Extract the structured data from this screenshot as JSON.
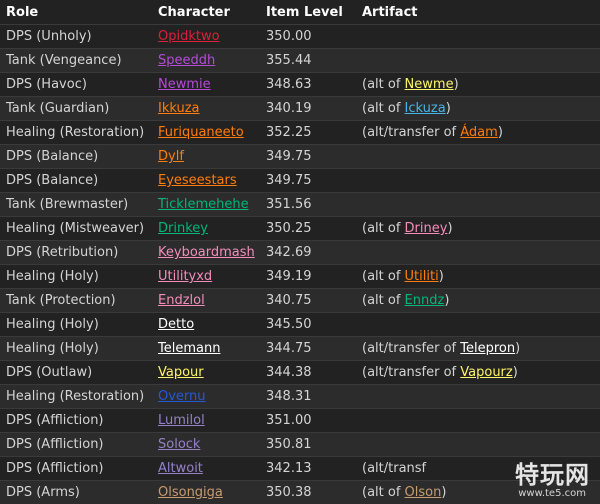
{
  "table": {
    "headers": {
      "role": "Role",
      "character": "Character",
      "item_level": "Item Level",
      "artifact": "Artifact"
    },
    "rows": [
      {
        "role": "DPS (Unholy)",
        "character": "Opidktwo",
        "color": "#d9213a",
        "ilvl": "350.00",
        "note": null
      },
      {
        "role": "Tank (Vengeance)",
        "character": "Speeddh",
        "color": "#b44bd6",
        "ilvl": "355.44",
        "note": null
      },
      {
        "role": "DPS (Havoc)",
        "character": "Newmie",
        "color": "#b44bd6",
        "ilvl": "348.63",
        "note": {
          "prefix": "(alt of ",
          "name": "Newme",
          "color": "#fff468",
          "suffix": ")"
        }
      },
      {
        "role": "Tank (Guardian)",
        "character": "Ikkuza",
        "color": "#ff7d0a",
        "ilvl": "340.19",
        "note": {
          "prefix": "(alt of ",
          "name": "Ickuza",
          "color": "#45b6e8",
          "suffix": ")"
        }
      },
      {
        "role": "Healing (Restoration)",
        "character": "Furiquaneeto",
        "color": "#ff7d0a",
        "ilvl": "352.25",
        "note": {
          "prefix": "(alt/transfer of ",
          "name": "Ádam",
          "color": "#ff7d0a",
          "suffix": ")"
        }
      },
      {
        "role": "DPS (Balance)",
        "character": "Dylf",
        "color": "#ff7d0a",
        "ilvl": "349.75",
        "note": null
      },
      {
        "role": "DPS (Balance)",
        "character": "Eyeseestars",
        "color": "#ff7d0a",
        "ilvl": "349.75",
        "note": null
      },
      {
        "role": "Tank (Brewmaster)",
        "character": "Ticklemehehe",
        "color": "#00b77a",
        "ilvl": "351.56",
        "note": null
      },
      {
        "role": "Healing (Mistweaver)",
        "character": "Drinkey",
        "color": "#00b77a",
        "ilvl": "350.25",
        "note": {
          "prefix": "(alt of ",
          "name": "Driney",
          "color": "#f58cba",
          "suffix": ")"
        }
      },
      {
        "role": "DPS (Retribution)",
        "character": "Keyboardmash",
        "color": "#f58cba",
        "ilvl": "342.69",
        "note": null
      },
      {
        "role": "Healing (Holy)",
        "character": "Utilityxd",
        "color": "#f58cba",
        "ilvl": "349.19",
        "note": {
          "prefix": "(alt of ",
          "name": "Utiliti",
          "color": "#ff7d0a",
          "suffix": ")"
        }
      },
      {
        "role": "Tank (Protection)",
        "character": "Endzlol",
        "color": "#f58cba",
        "ilvl": "340.75",
        "note": {
          "prefix": "(alt of ",
          "name": "Enndz",
          "color": "#00b77a",
          "suffix": ")"
        }
      },
      {
        "role": "Healing (Holy)",
        "character": "Detto",
        "color": "#ffffff",
        "ilvl": "345.50",
        "note": null
      },
      {
        "role": "Healing (Holy)",
        "character": "Telemann",
        "color": "#ffffff",
        "ilvl": "344.75",
        "note": {
          "prefix": "(alt/transfer of ",
          "name": "Telepron",
          "color": "#ffffff",
          "suffix": ")"
        }
      },
      {
        "role": "DPS (Outlaw)",
        "character": "Vapour",
        "color": "#fff468",
        "ilvl": "344.38",
        "note": {
          "prefix": "(alt/transfer of ",
          "name": "Vapourz",
          "color": "#fff468",
          "suffix": ")"
        }
      },
      {
        "role": "Healing (Restoration)",
        "character": "Overnu",
        "color": "#2459d6",
        "ilvl": "348.31",
        "note": null
      },
      {
        "role": "DPS (Affliction)",
        "character": "Lumilol",
        "color": "#9482c9",
        "ilvl": "351.00",
        "note": null
      },
      {
        "role": "DPS (Affliction)",
        "character": "Solock",
        "color": "#9482c9",
        "ilvl": "350.81",
        "note": null
      },
      {
        "role": "DPS (Affliction)",
        "character": "Altwoit",
        "color": "#9482c9",
        "ilvl": "342.13",
        "note": {
          "prefix": "(alt/transf",
          "name": "",
          "color": "#ffffff",
          "suffix": ""
        }
      },
      {
        "role": "DPS (Arms)",
        "character": "Olsongiga",
        "color": "#c79c6e",
        "ilvl": "350.38",
        "note": {
          "prefix": "(alt of ",
          "name": "Olson",
          "color": "#c79c6e",
          "suffix": ")"
        }
      }
    ]
  },
  "watermark": {
    "logo": "特玩网",
    "url": "www.te5.com"
  }
}
